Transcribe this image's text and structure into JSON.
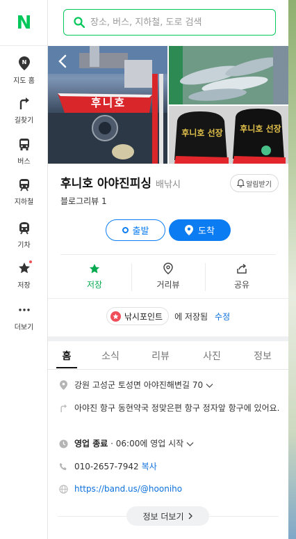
{
  "brand": {
    "logo_letter": "N",
    "color": "#03c75a"
  },
  "sidebar": {
    "items": [
      {
        "label": "지도 홈",
        "icon": "map-pin-n-icon"
      },
      {
        "label": "길찾기",
        "icon": "turn-arrow-icon"
      },
      {
        "label": "버스",
        "icon": "bus-icon"
      },
      {
        "label": "지하철",
        "icon": "subway-icon"
      },
      {
        "label": "기차",
        "icon": "train-icon"
      },
      {
        "label": "저장",
        "icon": "star-icon"
      },
      {
        "label": "더보기",
        "icon": "more-dots-icon"
      }
    ]
  },
  "search": {
    "placeholder": "장소, 버스, 지하철, 도로 검색"
  },
  "place": {
    "name": "후니호 아야진피싱",
    "category": "배낚시",
    "alarm_label": "알림받기",
    "review_text": "블로그리뷰 1",
    "photo_sign_text": "후니호",
    "cap_left_text": "후니호 선장",
    "cap_right_text": "후니호 선장"
  },
  "route": {
    "depart_label": "출발",
    "arrive_label": "도착"
  },
  "actions": [
    {
      "label": "저장",
      "icon": "star-icon",
      "active": true
    },
    {
      "label": "거리뷰",
      "icon": "location-pin-icon"
    },
    {
      "label": "공유",
      "icon": "share-icon"
    }
  ],
  "saved": {
    "chip_label": "낚시포인트",
    "saved_text": "에 저장됨",
    "edit_label": "수정"
  },
  "tabs": [
    "홈",
    "소식",
    "리뷰",
    "사진",
    "정보"
  ],
  "active_tab": "홈",
  "info": {
    "address": "강원 고성군 토성면 아야진해변길 70",
    "directions": "아야진 항구 동현약국 정맞은편 항구 정자앞 항구에 있어요.",
    "status": "영업 종료",
    "hours_text": " · 06:00에 영업 시작",
    "phone": "010-2657-7942",
    "copy_label": "복사",
    "url": "https://band.us/@hooniho",
    "more_label": "정보 더보기"
  },
  "colors": {
    "accent_green": "#03c75a",
    "accent_blue": "#0b7cf2",
    "link_blue": "#0b6fdc",
    "save_red": "#f04f5a"
  }
}
